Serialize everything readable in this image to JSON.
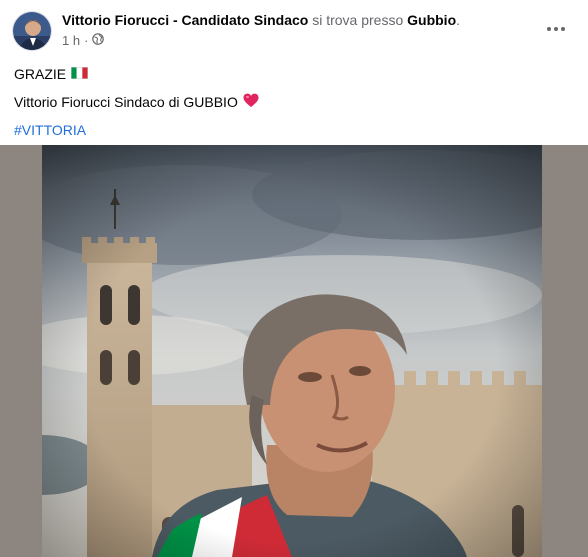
{
  "post": {
    "author": "Vittorio Fiorucci - Candidato Sindaco",
    "checkin_text": "si trova presso",
    "place": "Gubbio",
    "place_suffix": ".",
    "time": "1 h",
    "audience_icon": "globe-icon",
    "more_icon": "ellipsis-icon",
    "lines": {
      "line1": "GRAZIE",
      "line2": "Vittorio Fiorucci Sindaco di GUBBIO",
      "hashtag": "#VITTORIA"
    },
    "emoji": {
      "flag": "italian-flag",
      "heart": "red-heart"
    }
  },
  "colors": {
    "link_blue": "#216fdb",
    "secondary_text": "#65676b",
    "heart_red": "#e0245e",
    "flag_green": "#009246",
    "flag_red": "#ce2b37"
  }
}
